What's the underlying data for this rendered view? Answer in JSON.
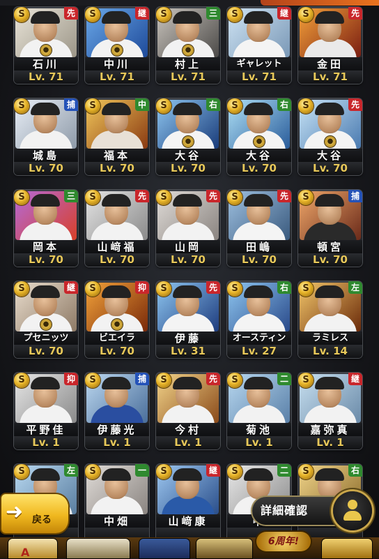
{
  "cards": [
    {
      "name": "石川",
      "level": "Lv. 71",
      "position": "先",
      "position_color": "#c9262b",
      "locked": true,
      "bg": "linear-gradient(135deg,#e9e4d8,#9c9688)",
      "uniform": "#f2f2f2"
    },
    {
      "name": "中川",
      "level": "Lv. 71",
      "position": "継",
      "position_color": "#c9262b",
      "locked": true,
      "bg": "linear-gradient(135deg,#6aa8e8,#1e4a9a)",
      "uniform": "#f2f2f2"
    },
    {
      "name": "村上",
      "level": "Lv. 71",
      "position": "三",
      "position_color": "#2f8a2f",
      "locked": true,
      "bg": "linear-gradient(135deg,#c9c4bd,#4c4a48)",
      "uniform": "#f2f2f2"
    },
    {
      "name": "ギャレット",
      "level": "Lv. 71",
      "position": "継",
      "position_color": "#c9262b",
      "locked": false,
      "bg": "linear-gradient(135deg,#cfe4f4,#7a98b6)",
      "uniform": "#f4f4f4"
    },
    {
      "name": "金田",
      "level": "Lv. 71",
      "position": "先",
      "position_color": "#c9262b",
      "locked": false,
      "bg": "linear-gradient(135deg,#f4a13a,#7a1e12)",
      "uniform": "#eaeaea"
    },
    {
      "name": "城島",
      "level": "Lv. 70",
      "position": "捕",
      "position_color": "#2452b8",
      "locked": false,
      "bg": "linear-gradient(135deg,#e8eef6,#8e9aa8)",
      "uniform": "#f2f2f2"
    },
    {
      "name": "福本",
      "level": "Lv. 70",
      "position": "中",
      "position_color": "#2f8a2f",
      "locked": false,
      "bg": "linear-gradient(135deg,#f0c65a,#8a3a12)",
      "uniform": "#e8e0d6"
    },
    {
      "name": "大谷",
      "level": "Lv. 70",
      "position": "右",
      "position_color": "#2f8a2f",
      "locked": true,
      "bg": "linear-gradient(135deg,#8ec6f0,#1a3c7a)",
      "uniform": "#f4f4f4"
    },
    {
      "name": "大谷",
      "level": "Lv. 70",
      "position": "右",
      "position_color": "#2f8a2f",
      "locked": true,
      "bg": "linear-gradient(135deg,#aee0f6,#2a5c9a)",
      "uniform": "#f4f4f4"
    },
    {
      "name": "大谷",
      "level": "Lv. 70",
      "position": "先",
      "position_color": "#c9262b",
      "locked": true,
      "bg": "linear-gradient(135deg,#c8e4f6,#4a7ab0)",
      "uniform": "#f4f4f4"
    },
    {
      "name": "岡本",
      "level": "Lv. 70",
      "position": "三",
      "position_color": "#2f8a2f",
      "locked": false,
      "bg": "linear-gradient(135deg,#b46ad8,#d8402a)",
      "uniform": "#f2f2f2"
    },
    {
      "name": "山﨑福",
      "level": "Lv. 70",
      "position": "先",
      "position_color": "#c9262b",
      "locked": false,
      "bg": "linear-gradient(135deg,#e4e4e4,#8a8a8a)",
      "uniform": "#f2f2f2"
    },
    {
      "name": "山岡",
      "level": "Lv. 70",
      "position": "先",
      "position_color": "#c9262b",
      "locked": false,
      "bg": "linear-gradient(135deg,#e0dcd8,#8a8480)",
      "uniform": "#f2f2f2"
    },
    {
      "name": "田嶋",
      "level": "Lv. 70",
      "position": "先",
      "position_color": "#c9262b",
      "locked": false,
      "bg": "linear-gradient(135deg,#9ec0e0,#3a5a7e)",
      "uniform": "#f4f4f4"
    },
    {
      "name": "頓宮",
      "level": "Lv. 70",
      "position": "捕",
      "position_color": "#2452b8",
      "locked": false,
      "bg": "linear-gradient(135deg,#f0a86a,#6a2a1a)",
      "uniform": "#2a2a2a"
    },
    {
      "name": "プセニッツ",
      "level": "Lv. 70",
      "position": "継",
      "position_color": "#c9262b",
      "locked": true,
      "bg": "linear-gradient(135deg,#e8dccc,#8e7a66)",
      "uniform": "#f2f2f2"
    },
    {
      "name": "ビエイラ",
      "level": "Lv. 70",
      "position": "抑",
      "position_color": "#c9262b",
      "locked": true,
      "bg": "linear-gradient(135deg,#f2a23a,#7a2a0a)",
      "uniform": "#f2f2f2"
    },
    {
      "name": "伊藤",
      "level": "Lv. 31",
      "position": "先",
      "position_color": "#c9262b",
      "locked": false,
      "bg": "linear-gradient(135deg,#8ec6f0,#1e3c7e)",
      "uniform": "#f4f4f4"
    },
    {
      "name": "オースティン",
      "level": "Lv. 27",
      "position": "右",
      "position_color": "#2f8a2f",
      "locked": false,
      "bg": "linear-gradient(135deg,#8ec6f0,#2a4a8a)",
      "uniform": "#f4f4f4"
    },
    {
      "name": "ラミレス",
      "level": "Lv. 14",
      "position": "左",
      "position_color": "#2f8a2f",
      "locked": false,
      "bg": "linear-gradient(135deg,#f2c66a,#6a2a0a)",
      "uniform": "#f2f2f2"
    },
    {
      "name": "平野佳",
      "level": "Lv.  1",
      "position": "抑",
      "position_color": "#c9262b",
      "locked": false,
      "bg": "linear-gradient(135deg,#e6e6e6,#8a8a8a)",
      "uniform": "#f2f2f2"
    },
    {
      "name": "伊藤光",
      "level": "Lv.  1",
      "position": "捕",
      "position_color": "#2452b8",
      "locked": false,
      "bg": "linear-gradient(135deg,#bcd8f0,#4a6e9a)",
      "uniform": "#2a4ea0"
    },
    {
      "name": "今村",
      "level": "Lv.  1",
      "position": "先",
      "position_color": "#c9262b",
      "locked": false,
      "bg": "linear-gradient(135deg,#f2d48a,#8a4a1a)",
      "uniform": "#f2f2f2"
    },
    {
      "name": "菊池",
      "level": "Lv.  1",
      "position": "二",
      "position_color": "#2f8a2f",
      "locked": false,
      "bg": "linear-gradient(135deg,#b8d8f0,#5a80a8)",
      "uniform": "#f2f2f2"
    },
    {
      "name": "嘉弥真",
      "level": "Lv.  1",
      "position": "継",
      "position_color": "#c9262b",
      "locked": false,
      "bg": "linear-gradient(135deg,#c8e0f0,#6a8aa8)",
      "uniform": "#f2f2f2"
    },
    {
      "name": "",
      "level": "",
      "position": "左",
      "position_color": "#2f8a2f",
      "locked": false,
      "bg": "linear-gradient(135deg,#b8d8f0,#5a7ea0)",
      "uniform": "#f2f2f2"
    },
    {
      "name": "中畑",
      "level": "",
      "position": "一",
      "position_color": "#2f8a2f",
      "locked": false,
      "bg": "linear-gradient(135deg,#e0dcd8,#8a8480)",
      "uniform": "#f2f2f2"
    },
    {
      "name": "山﨑康",
      "level": "",
      "position": "継",
      "position_color": "#c9262b",
      "locked": false,
      "bg": "linear-gradient(135deg,#9ec8f0,#2a4e8a)",
      "uniform": "#2a5aa8"
    },
    {
      "name": "中",
      "level": "",
      "position": "二",
      "position_color": "#2f8a2f",
      "locked": false,
      "bg": "linear-gradient(135deg,#e8e8e8,#8e8e8e)",
      "uniform": "#f2f2f2"
    },
    {
      "name": "",
      "level": "",
      "position": "右",
      "position_color": "#2f8a2f",
      "locked": false,
      "bg": "linear-gradient(135deg,#f0d48a,#8a6a2a)",
      "uniform": "#f2f2f2"
    }
  ],
  "back_button": {
    "arrow": "➜",
    "label": "戻る"
  },
  "detail_button": {
    "label": "詳細確認",
    "icon": "person-icon"
  },
  "anniversary_badge": {
    "label": "6周年!"
  },
  "s_badge_letter": "S",
  "lock_glyph": "🔒"
}
